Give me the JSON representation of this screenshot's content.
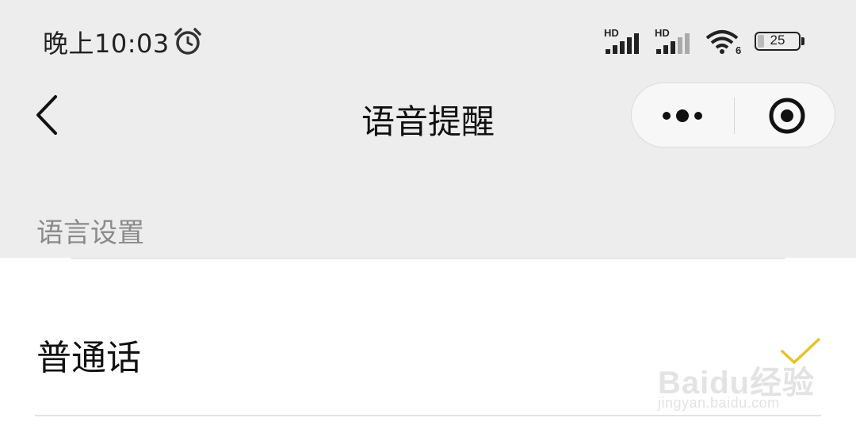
{
  "status_bar": {
    "time": "晚上10:03",
    "signal_1_label": "HD",
    "signal_2_label": "HD",
    "wifi_label": "6",
    "battery_level": "25",
    "icons": [
      "alarm-icon",
      "signal-icon",
      "signal-icon",
      "wifi-icon",
      "battery-icon"
    ]
  },
  "nav": {
    "title": "语音提醒",
    "back_icon": "chevron-left-icon",
    "more_icon": "more-dots-icon",
    "close_icon": "target-circle-icon"
  },
  "section": {
    "header": "语言设置",
    "items": [
      {
        "label": "普通话",
        "selected": true
      }
    ]
  },
  "colors": {
    "background": "#ededed",
    "content_background": "#ffffff",
    "check_accent": "#e6c22a",
    "section_header_text": "#8a8a8a"
  },
  "watermark": {
    "logo": "Baidu经验",
    "url": "jingyan.baidu.com"
  }
}
